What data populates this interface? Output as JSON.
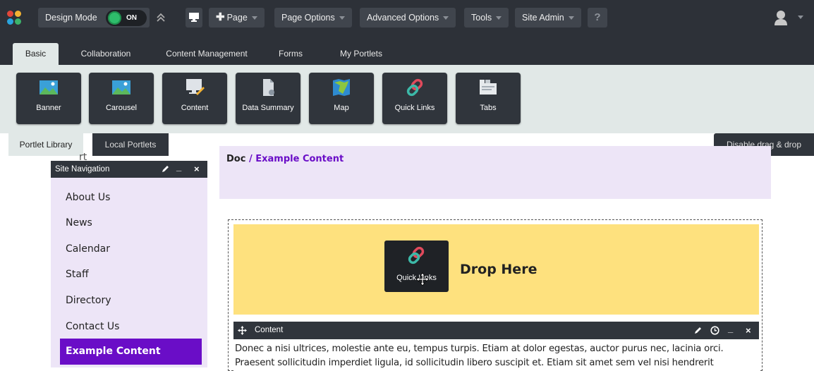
{
  "toolbar": {
    "design_mode_label": "Design Mode",
    "toggle_state": "ON",
    "page_label": "Page",
    "page_options_label": "Page Options",
    "advanced_options_label": "Advanced Options",
    "tools_label": "Tools",
    "site_admin_label": "Site Admin",
    "help_label": "?"
  },
  "tabs": [
    "Basic",
    "Collaboration",
    "Content Management",
    "Forms",
    "My Portlets"
  ],
  "active_tab": "Basic",
  "portlets": [
    {
      "label": "Banner",
      "icon": "image-icon"
    },
    {
      "label": "Carousel",
      "icon": "image-icon"
    },
    {
      "label": "Content",
      "icon": "monitor-pencil-icon"
    },
    {
      "label": "Data Summary",
      "icon": "document-icon"
    },
    {
      "label": "Map",
      "icon": "map-icon"
    },
    {
      "label": "Quick Links",
      "icon": "link-icon"
    },
    {
      "label": "Tabs",
      "icon": "tabs-icon"
    }
  ],
  "library_tabs": {
    "portlet_library": "Portlet Library",
    "local_portlets": "Local Portlets"
  },
  "disable_drag_drop_label": "Disable drag & drop",
  "site_navigation": {
    "title": "Site Navigation",
    "items": [
      "About Us",
      "News",
      "Calendar",
      "Staff",
      "Directory",
      "Contact Us"
    ],
    "active_item": "Example Content"
  },
  "obscured_text": "rt",
  "breadcrumb": {
    "doc": "Doc",
    "separator": " / ",
    "current": "Example Content"
  },
  "drop_zone": {
    "text": "Drop Here",
    "dragged_portlet_label": "Quick Links"
  },
  "content_portlet": {
    "title": "Content",
    "body": "Donec a nisi ultrices, molestie ante eu, tempus turpis. Etiam at dolor egestas, auctor purus nec, lacinia orci. Praesent sollicitudin imperdiet ligula, id sollicitudin libero suscipit et. Etiam sit amet sem vel nisi hendrerit"
  },
  "colors": {
    "toolbar_bg": "#2d3138",
    "palette_bg": "#e1e8e7",
    "accent_purple": "#6a0dc7",
    "nav_bg": "#ede5f7",
    "drop_bg": "#fee17e",
    "toggle_on": "#2ebd6b"
  }
}
